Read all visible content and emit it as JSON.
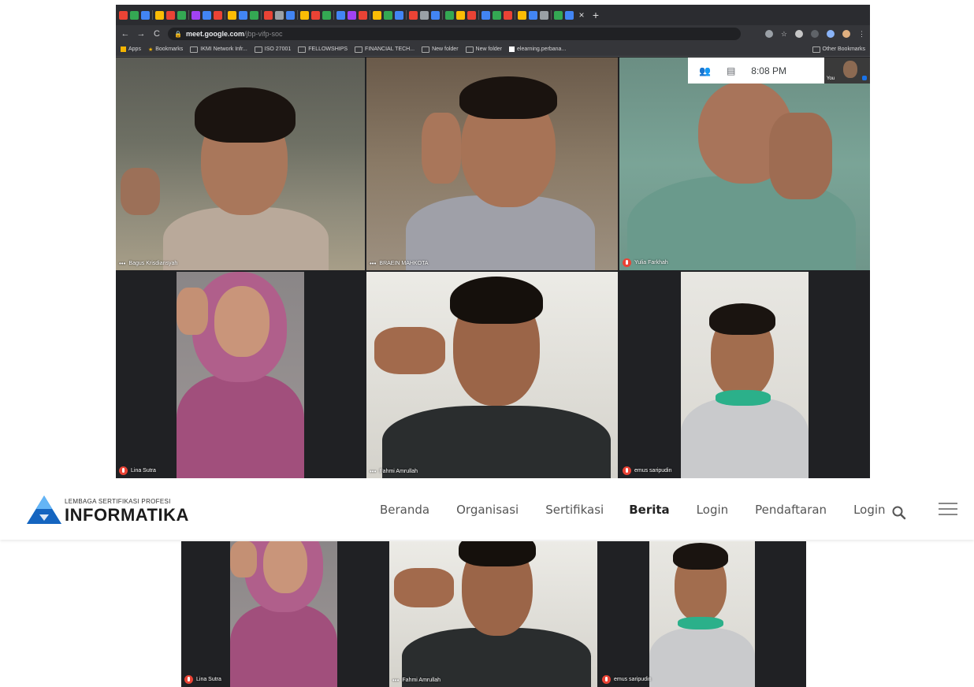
{
  "browser": {
    "url_host": "meet.google.com",
    "url_path": "/jbp-vifp-soc",
    "bookmarks": [
      "Apps",
      "Bookmarks",
      "IKMI Network Infr...",
      "ISO 27001",
      "FELLOWSHIPS",
      "FINANCIAL TECH...",
      "New folder",
      "New folder",
      "elearning.perbana..."
    ],
    "other_bookmarks": "Other Bookmarks"
  },
  "meet": {
    "time": "8:08 PM",
    "self_label": "You",
    "participants": [
      {
        "name": "Bagus Krisdiansyah",
        "muted": false
      },
      {
        "name": "BRAEIN MAHKOTA",
        "muted": false
      },
      {
        "name": "Yulia Farkhah",
        "muted": true
      },
      {
        "name": "Lina Sutra",
        "muted": true
      },
      {
        "name": "Fahmi Amrullah",
        "muted": false
      },
      {
        "name": "emus saripudin",
        "muted": true
      }
    ]
  },
  "site": {
    "brand_sub": "LEMBAGA SERTIFIKASI PROFESI",
    "brand": "INFORMATIKA",
    "nav": [
      "Beranda",
      "Organisasi",
      "Sertifikasi",
      "Berita",
      "Login",
      "Pendaftaran",
      "Login"
    ],
    "active_nav": "Berita",
    "colors": {
      "logo_blue": "#1e88e5",
      "logo_dark": "#0d47a1",
      "meet_red": "#ea4335"
    }
  }
}
